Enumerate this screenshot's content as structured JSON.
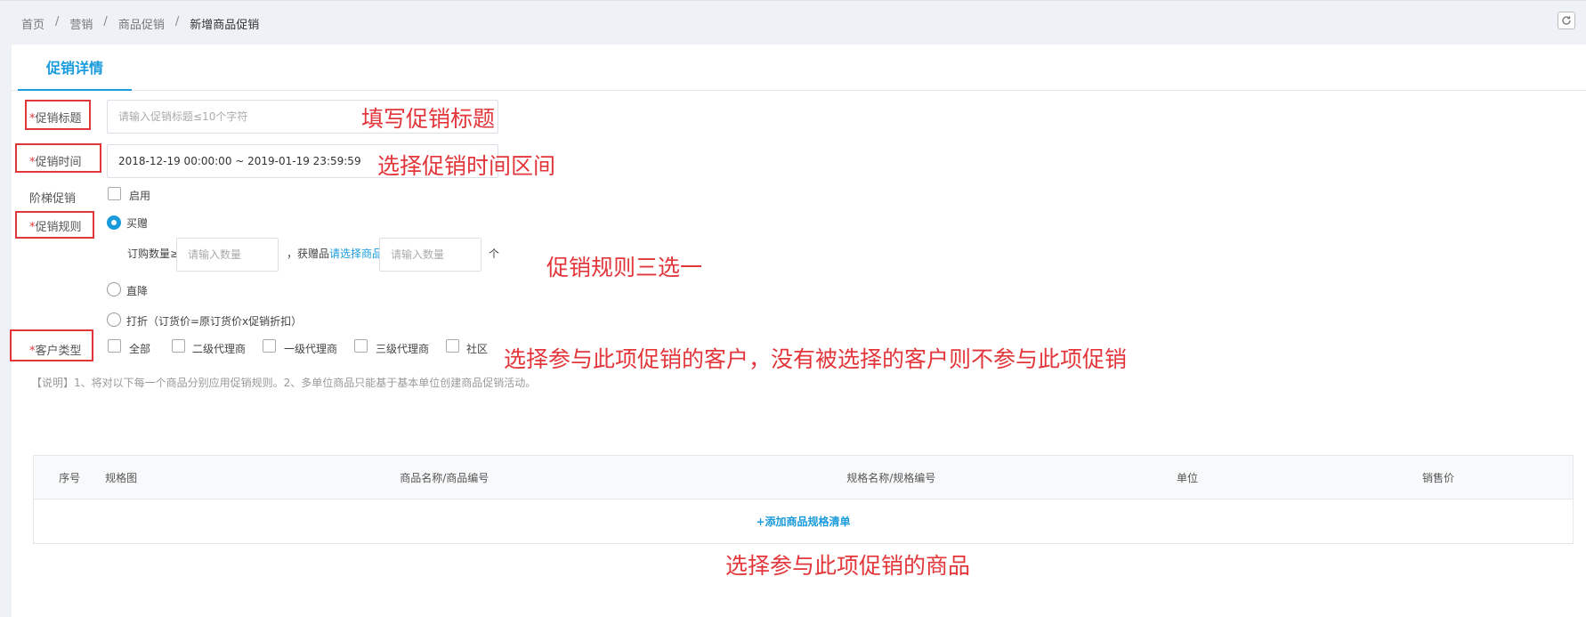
{
  "breadcrumb": [
    {
      "label": "首页"
    },
    {
      "label": "营销"
    },
    {
      "label": "商品促销"
    },
    {
      "label": "新增商品促销"
    }
  ],
  "tab": {
    "label": "促销详情"
  },
  "form": {
    "title": {
      "label": "促销标题",
      "placeholder": "请输入促销标题≤10个字符"
    },
    "time": {
      "label": "促销时间",
      "value": "2018-12-19 00:00:00 ~ 2019-01-19 23:59:59"
    },
    "tier": {
      "label": "阶梯促销",
      "option": "启用"
    },
    "rule": {
      "label": "促销规则",
      "options": [
        "买赠",
        "直降",
        "打折（订货价=原订货价x促销折扣）"
      ],
      "selected": 0,
      "qty_label": "订购数量≥",
      "qty_placeholder": "请输入数量",
      "gift_label": "，获赠品",
      "gift_link": "请选择商品",
      "gift_placeholder": "请输入数量",
      "unit": "个"
    },
    "customer": {
      "label": "客户类型",
      "options": [
        "全部",
        "二级代理商",
        "一级代理商",
        "三级代理商",
        "社区"
      ]
    },
    "required_mark": "*"
  },
  "note": "【说明】1、将对以下每一个商品分别应用促销规则。2、多单位商品只能基于基本单位创建商品促销活动。",
  "table": {
    "columns": [
      "序号",
      "规格图",
      "商品名称/商品编号",
      "规格名称/规格编号",
      "单位",
      "销售价"
    ],
    "add_label": "+添加商品规格清单"
  },
  "annotations": {
    "title": "填写促销标题",
    "time": "选择促销时间区间",
    "rule": "促销规则三选一",
    "customer": "选择参与此项促销的客户，没有被选择的客户则不参与此项促销",
    "goods": "选择参与此项促销的商品"
  },
  "colors": {
    "accent": "#1a9bdc",
    "annotation": "#e2363b"
  }
}
